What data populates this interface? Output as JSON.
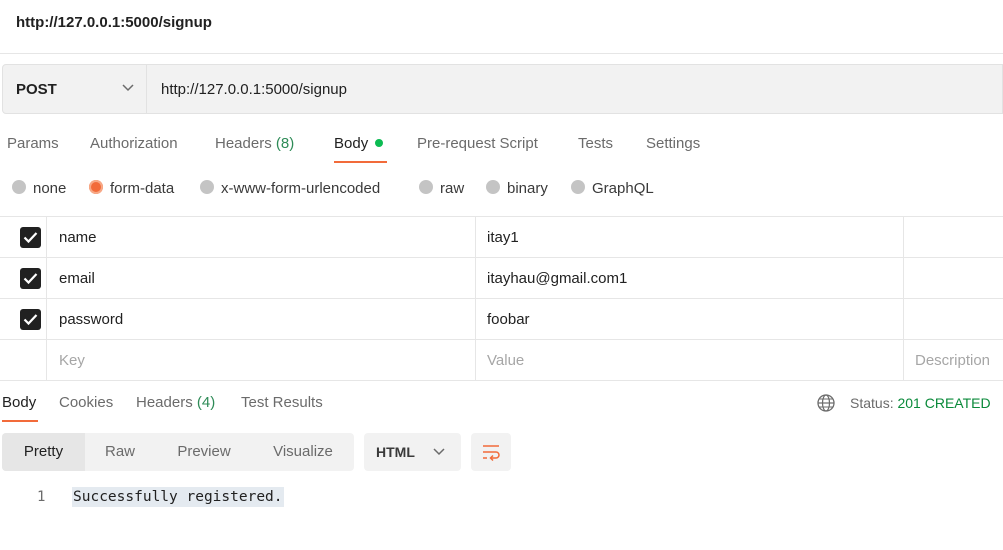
{
  "title": "http://127.0.0.1:5000/signup",
  "request": {
    "method": "POST",
    "url": "http://127.0.0.1:5000/signup"
  },
  "request_tabs": {
    "params": "Params",
    "authorization": "Authorization",
    "headers_label": "Headers",
    "headers_count": "(8)",
    "body": "Body",
    "prerequest": "Pre-request Script",
    "tests": "Tests",
    "settings": "Settings"
  },
  "body_types": {
    "none": "none",
    "form_data": "form-data",
    "urlencoded": "x-www-form-urlencoded",
    "raw": "raw",
    "binary": "binary",
    "graphql": "GraphQL",
    "selected": "form-data"
  },
  "form_fields": [
    {
      "key": "name",
      "value": "itay1",
      "checked": true
    },
    {
      "key": "email",
      "value": "itayhau@gmail.com1",
      "checked": true
    },
    {
      "key": "password",
      "value": "foobar",
      "checked": true
    }
  ],
  "form_placeholders": {
    "key": "Key",
    "value": "Value",
    "description": "Description"
  },
  "response_tabs": {
    "body": "Body",
    "cookies": "Cookies",
    "headers_label": "Headers",
    "headers_count": "(4)",
    "test_results": "Test Results"
  },
  "status": {
    "label": "Status:",
    "code": "201 CREATED"
  },
  "view_modes": {
    "pretty": "Pretty",
    "raw": "Raw",
    "preview": "Preview",
    "visualize": "Visualize",
    "selected": "Pretty"
  },
  "format": "HTML",
  "response_body": {
    "line_number": "1",
    "content": "Successfully registered."
  },
  "colors": {
    "accent": "#f26b3a",
    "success": "#0cbb52",
    "count": "#2e8b57"
  }
}
